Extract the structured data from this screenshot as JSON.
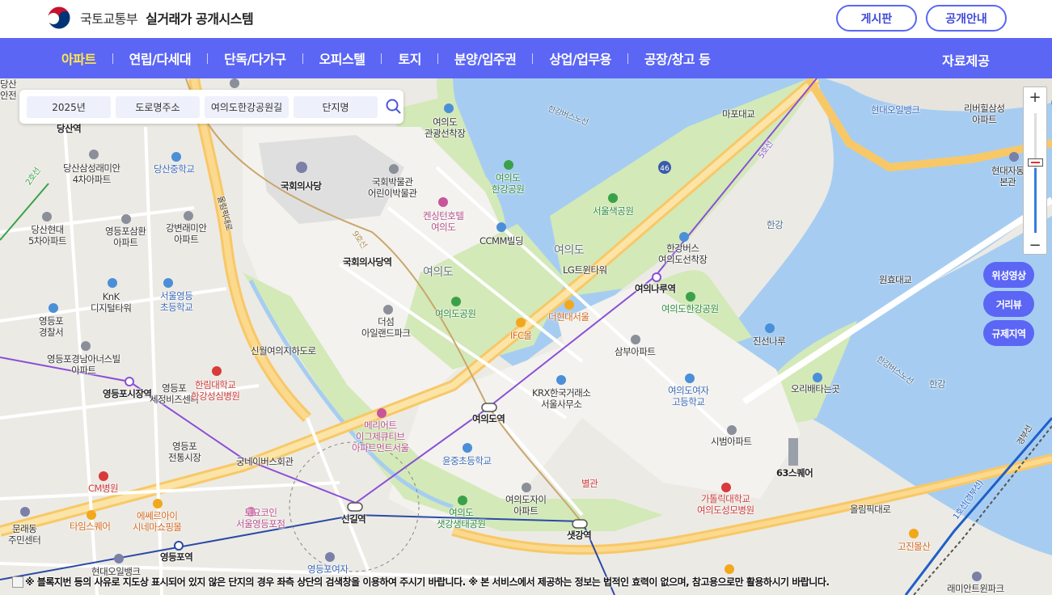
{
  "header": {
    "ministry": "국토교통부",
    "system": "실거래가 공개시스템",
    "board_label": "게시판",
    "guide_label": "공개안내"
  },
  "nav": {
    "items": [
      "아파트",
      "연립/다세대",
      "단독/다가구",
      "오피스텔",
      "토지",
      "분양/입주권",
      "상업/업무용",
      "공장/창고 등"
    ],
    "active_index": 0,
    "right_label": "자료제공"
  },
  "search": {
    "year": "2025년",
    "road_address": "도로명주소",
    "place": "여의도한강공원길",
    "complex": "단지명"
  },
  "zoom": {
    "plus": "+",
    "minus": "−",
    "level": 0.54
  },
  "side_buttons": [
    "위성영상",
    "거리뷰",
    "규제지역"
  ],
  "notice": "※ 블록지번 등의 사유로 지도상 표시되어 있지 않은 단지의 경우 좌측 상단의 검색창을 이용하여 주시기 바랍니다. ※ 본 서비스에서 제공하는 정보는 법적인 효력이 없으며, 참고용으로만 활용하시기 바랍니다.",
  "colors": {
    "nav_bg": "#5b66f5",
    "nav_active": "#ffe84d",
    "water": "#a6cdf1",
    "park": "#d3e9b8",
    "road_major": "#f8c867"
  },
  "map_labels": {
    "dangsan_station": "당산역",
    "dangsan_edu": "당산삼성래미안\n4차아파트",
    "dangsan_mid": "당산중학교",
    "dangsan_hyundai": "당산현대\n5차아파트",
    "yd_samhwan": "영등포삼환\n아파트",
    "gangbyeon": "강변래미안\n아파트",
    "knk": "KnK\n디지털타워",
    "yd_elem": "서울영등\n초등학교",
    "yd_police": "영등포\n경찰서",
    "yd_gyeongnam": "영등포경남아너스빌\n아파트",
    "yd_market_st": "영등포시장역",
    "yd_hall": "영등포\n세정비즈센터",
    "hallym": "한림대학교\n한강성심병원",
    "yd_trad_market": "영등포\n전통시장",
    "cm_hospital": "CM병원",
    "times_square": "타임스퀘어",
    "munrae": "문래동\n주민센터",
    "esquire": "에쎄르아이\n시네마쇼핑몰",
    "hyundai_dept": "현대오일뱅크",
    "yd_station": "영등포역",
    "national_assembly": "국회의사당",
    "museum": "국회박물관\n어린이박물관",
    "kensington": "켄싱턴호텔\n여의도",
    "ccmm": "CCMM빌딩",
    "na_station": "국회의사당역",
    "yeouido_big": "여의도",
    "yeouido_big2": "여의도",
    "the_island": "더섬\n아일랜드파크",
    "sinwol": "신월여의지하도로",
    "yeouido_park": "여의도공원",
    "meriott": "메리어트\n이그제큐티브\n아파트먼트서울",
    "yunjung": "윤중초등학교",
    "gunnam": "궁네이버스회관",
    "toyo": "토요코인\n서울영등포점",
    "singil": "신길역",
    "yd_school": "영등포여자",
    "ifc": "IFC몰",
    "hyundai_seoul": "더현대서울",
    "krx": "KRX한국거래소\n서울사무소",
    "yeouido_station": "여의도역",
    "samboo": "삼부아파트",
    "yd_hs": "여의도여자\n고등학교",
    "sibum": "시범아파트",
    "byeolgwan": "별관",
    "yd_jasi": "여의도자이\n아파트",
    "saetgang_park": "여의도\n샛강생태공원",
    "saetgang_st": "샛강역",
    "catholic": "가톨릭대학교\n여의도성모병원",
    "sq63": "63스퀘어",
    "olympic": "올림픽대로",
    "goshin": "고진몰산",
    "raemian": "래미안트윈파크",
    "lg": "LG트윈타워",
    "naru_st": "여의나루역",
    "yd_hangang_park": "여의도한강공원",
    "seoulsaek": "서울색공원",
    "yd_hangang_park2": "여의도\n한강공원",
    "yd_ferry": "여의도\n관광선착장",
    "hangang_bus": "한강버스\n여의도선착장",
    "mapo_bridge": "마포대교",
    "hangang": "한강",
    "hangang2": "한강",
    "wonhyo": "원효대교",
    "jinseong": "진선나루",
    "oribeta": "오리배타는곳",
    "hyundai_oil2": "현대오일뱅크",
    "riverview": "리버힐삼성\n아파트",
    "hyundai_car": "현대자동\n본관",
    "hangang_bus_route": "한강버스노선",
    "hangang_bus_route2": "한강버스노선",
    "line5": "5호선",
    "line9": "9호선",
    "line2": "2호선",
    "line1": "1호선(경부선)",
    "gyeongbu": "경부선",
    "olympic_daero": "올림픽대로",
    "route46": "46",
    "dangsan_anjeon": "당산\n안전"
  }
}
